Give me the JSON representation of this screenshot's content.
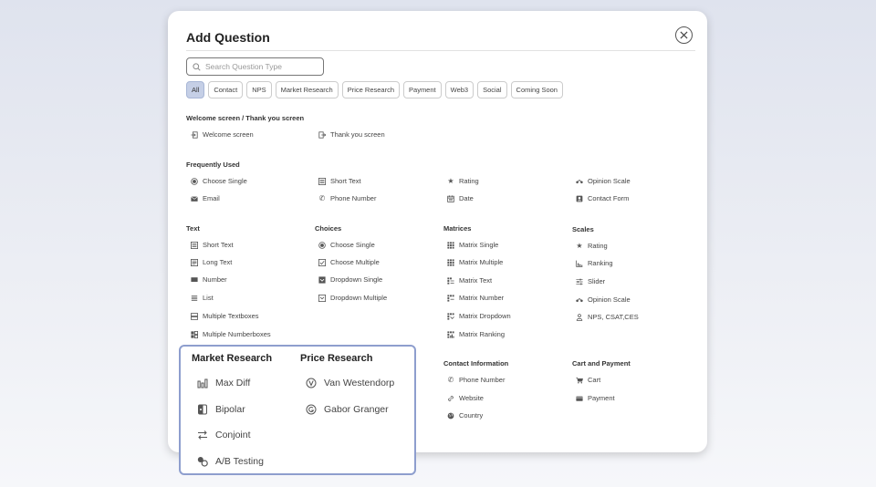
{
  "modal": {
    "title": "Add Question",
    "search_placeholder": "Search Question Type",
    "tabs": [
      "All",
      "Contact",
      "NPS",
      "Market Research",
      "Price Research",
      "Payment",
      "Web3",
      "Social",
      "Coming Soon"
    ],
    "active_tab": "All"
  },
  "sections": {
    "welcome": {
      "title": "Welcome screen / Thank you screen",
      "items": [
        "Welcome screen",
        "Thank you screen"
      ]
    },
    "frequent": {
      "title": "Frequently Used",
      "items": [
        "Choose Single",
        "Short Text",
        "Rating",
        "Opinion Scale",
        "Email",
        "Phone Number",
        "Date",
        "Contact Form"
      ]
    },
    "text": {
      "title": "Text",
      "items": [
        "Short Text",
        "Long Text",
        "Number",
        "List",
        "Multiple Textboxes",
        "Multiple Numberboxes"
      ]
    },
    "choices": {
      "title": "Choices",
      "items": [
        "Choose Single",
        "Choose Multiple",
        "Dropdown Single",
        "Dropdown Multiple"
      ]
    },
    "matrices": {
      "title": "Matrices",
      "items": [
        "Matrix Single",
        "Matrix Multiple",
        "Matrix Text",
        "Matrix Number",
        "Matrix Dropdown",
        "Matrix Ranking"
      ]
    },
    "scales": {
      "title": "Scales",
      "items": [
        "Rating",
        "Ranking",
        "Slider",
        "Opinion Scale",
        "NPS, CSAT,CES"
      ]
    },
    "contact": {
      "title": "Contact Information",
      "items": [
        "Phone Number",
        "Website",
        "Country"
      ]
    },
    "cart": {
      "title": "Cart and Payment",
      "items": [
        "Cart",
        "Payment"
      ]
    }
  },
  "overlay": {
    "market": {
      "title": "Market Research",
      "items": [
        "Max Diff",
        "Bipolar",
        "Conjoint",
        "A/B Testing"
      ]
    },
    "price": {
      "title": "Price Research",
      "items": [
        "Van Westendorp",
        "Gabor Granger"
      ]
    }
  }
}
